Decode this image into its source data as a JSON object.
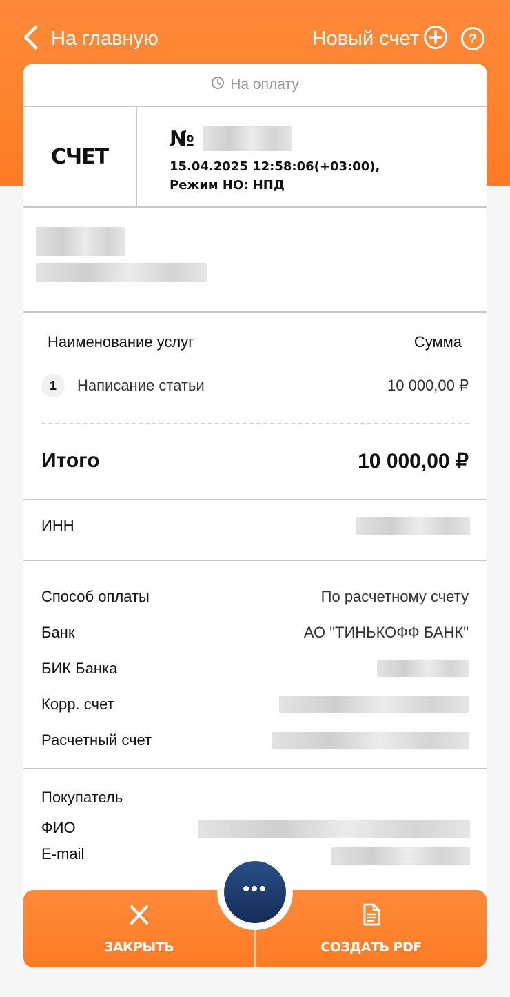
{
  "header": {
    "back_label": "На главную",
    "new_bill_label": "Новый счет"
  },
  "status": {
    "label": "На оплату"
  },
  "invoice": {
    "type_label": "СЧЕТ",
    "number_prefix": "№",
    "datetime": "15.04.2025 12:58:06(+03:00),",
    "mode": "Режим НО: НПД"
  },
  "services": {
    "col_name": "Наименование услуг",
    "col_sum": "Сумма",
    "items": [
      {
        "index": "1",
        "name": "Написание статьи",
        "amount": "10 000,00 ₽"
      }
    ],
    "total_label": "Итого",
    "total_value": "10 000,00 ₽"
  },
  "inn": {
    "label": "ИНН"
  },
  "payment": {
    "method_label": "Способ оплаты",
    "method_value": "По расчетному счету",
    "bank_label": "Банк",
    "bank_value": "АО \"ТИНЬКОФФ БАНК\"",
    "bik_label": "БИК Банка",
    "corr_label": "Корр. счет",
    "account_label": "Расчетный счет"
  },
  "buyer": {
    "title": "Покупатель",
    "fio_label": "ФИО",
    "email_label": "E-mail"
  },
  "actions": {
    "close_label": "ЗАКРЫТЬ",
    "pdf_label": "СОЗДАТЬ PDF",
    "more_label": "•••"
  },
  "colors": {
    "accent": "#ff7b25",
    "fab": "#1f3f73"
  }
}
